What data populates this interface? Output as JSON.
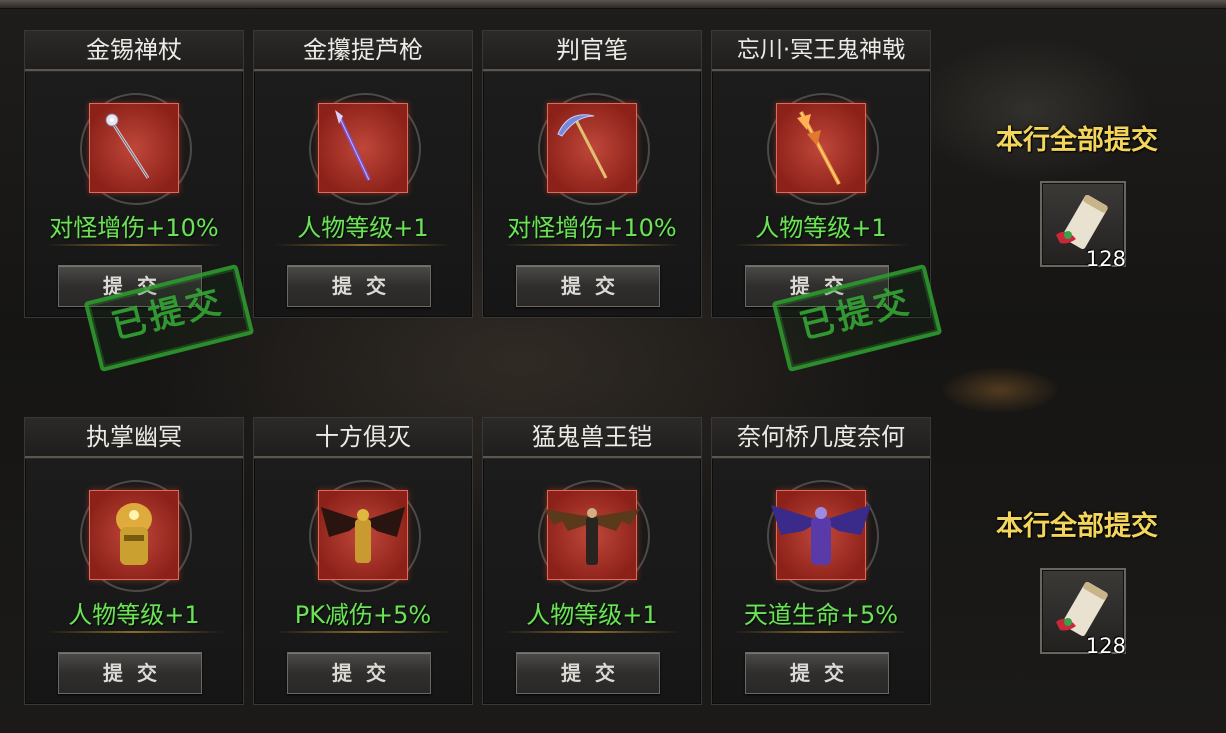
{
  "cards": [
    {
      "name": "金锡禅杖",
      "effect": "对怪增伤+10%",
      "button": "提交",
      "submitted": true,
      "stamp": "已提交"
    },
    {
      "name": "金攥提芦枪",
      "effect": "人物等级+1",
      "button": "提交",
      "submitted": false
    },
    {
      "name": "判官笔",
      "effect": "对怪增伤+10%",
      "button": "提交",
      "submitted": false
    },
    {
      "name": "忘川·冥王鬼神戟",
      "effect": "人物等级+1",
      "button": "提交",
      "submitted": true,
      "stamp": "已提交"
    },
    {
      "name": "执掌幽冥",
      "effect": "人物等级+1",
      "button": "提交",
      "submitted": false
    },
    {
      "name": "十方俱灭",
      "effect": "PK减伤+5%",
      "button": "提交",
      "submitted": false
    },
    {
      "name": "猛鬼兽王铠",
      "effect": "人物等级+1",
      "button": "提交",
      "submitted": false
    },
    {
      "name": "奈何桥几度奈何",
      "effect": "天道生命+5%",
      "button": "提交",
      "submitted": false
    }
  ],
  "rows": [
    {
      "label": "本行全部提交",
      "reward_count": "128",
      "reward_icon": "scroll-icon"
    },
    {
      "label": "本行全部提交",
      "reward_count": "128",
      "reward_icon": "scroll-icon"
    }
  ],
  "colors": {
    "effect": "#6ee05a",
    "stamp": "#2f9a2f",
    "row_label": "#f2d55a",
    "item_bg": "#a8342a"
  }
}
